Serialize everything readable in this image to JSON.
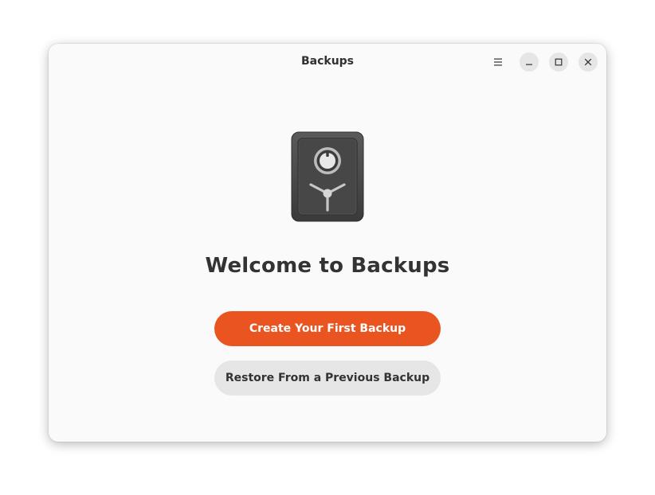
{
  "window": {
    "title": "Backups"
  },
  "headerbar": {
    "menu_icon": "hamburger-menu-icon",
    "minimize_icon": "minimize-icon",
    "maximize_icon": "maximize-icon",
    "close_icon": "close-icon"
  },
  "main": {
    "app_icon": "safe-icon",
    "heading": "Welcome to Backups",
    "primary_button_label": "Create Your First Backup",
    "secondary_button_label": "Restore From a Previous Backup"
  },
  "colors": {
    "accent": "#e95420",
    "secondary_button": "#e6e6e6",
    "window_background": "#fafafa",
    "text": "#333333"
  }
}
